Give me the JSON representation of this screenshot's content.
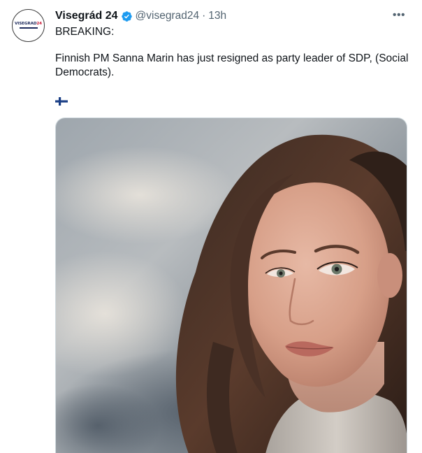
{
  "author": {
    "display_name": "Visegrád 24",
    "handle": "@visegrad24",
    "time": "13h",
    "avatar_logo_text": "VISEGRAD24"
  },
  "tweet": {
    "line1": "BREAKING:",
    "line2": "Finnish PM Sanna Marin has just resigned as party leader of SDP, (Social Democrats).",
    "flag_emoji": "flag-finland"
  },
  "icons": {
    "verified": "verified-badge-icon",
    "more": "more-icon"
  },
  "colors": {
    "verified_blue": "#1d9bf0",
    "secondary_text": "#536471",
    "primary_text": "#0f1419"
  },
  "media": {
    "type": "photo",
    "subject": "portrait"
  }
}
